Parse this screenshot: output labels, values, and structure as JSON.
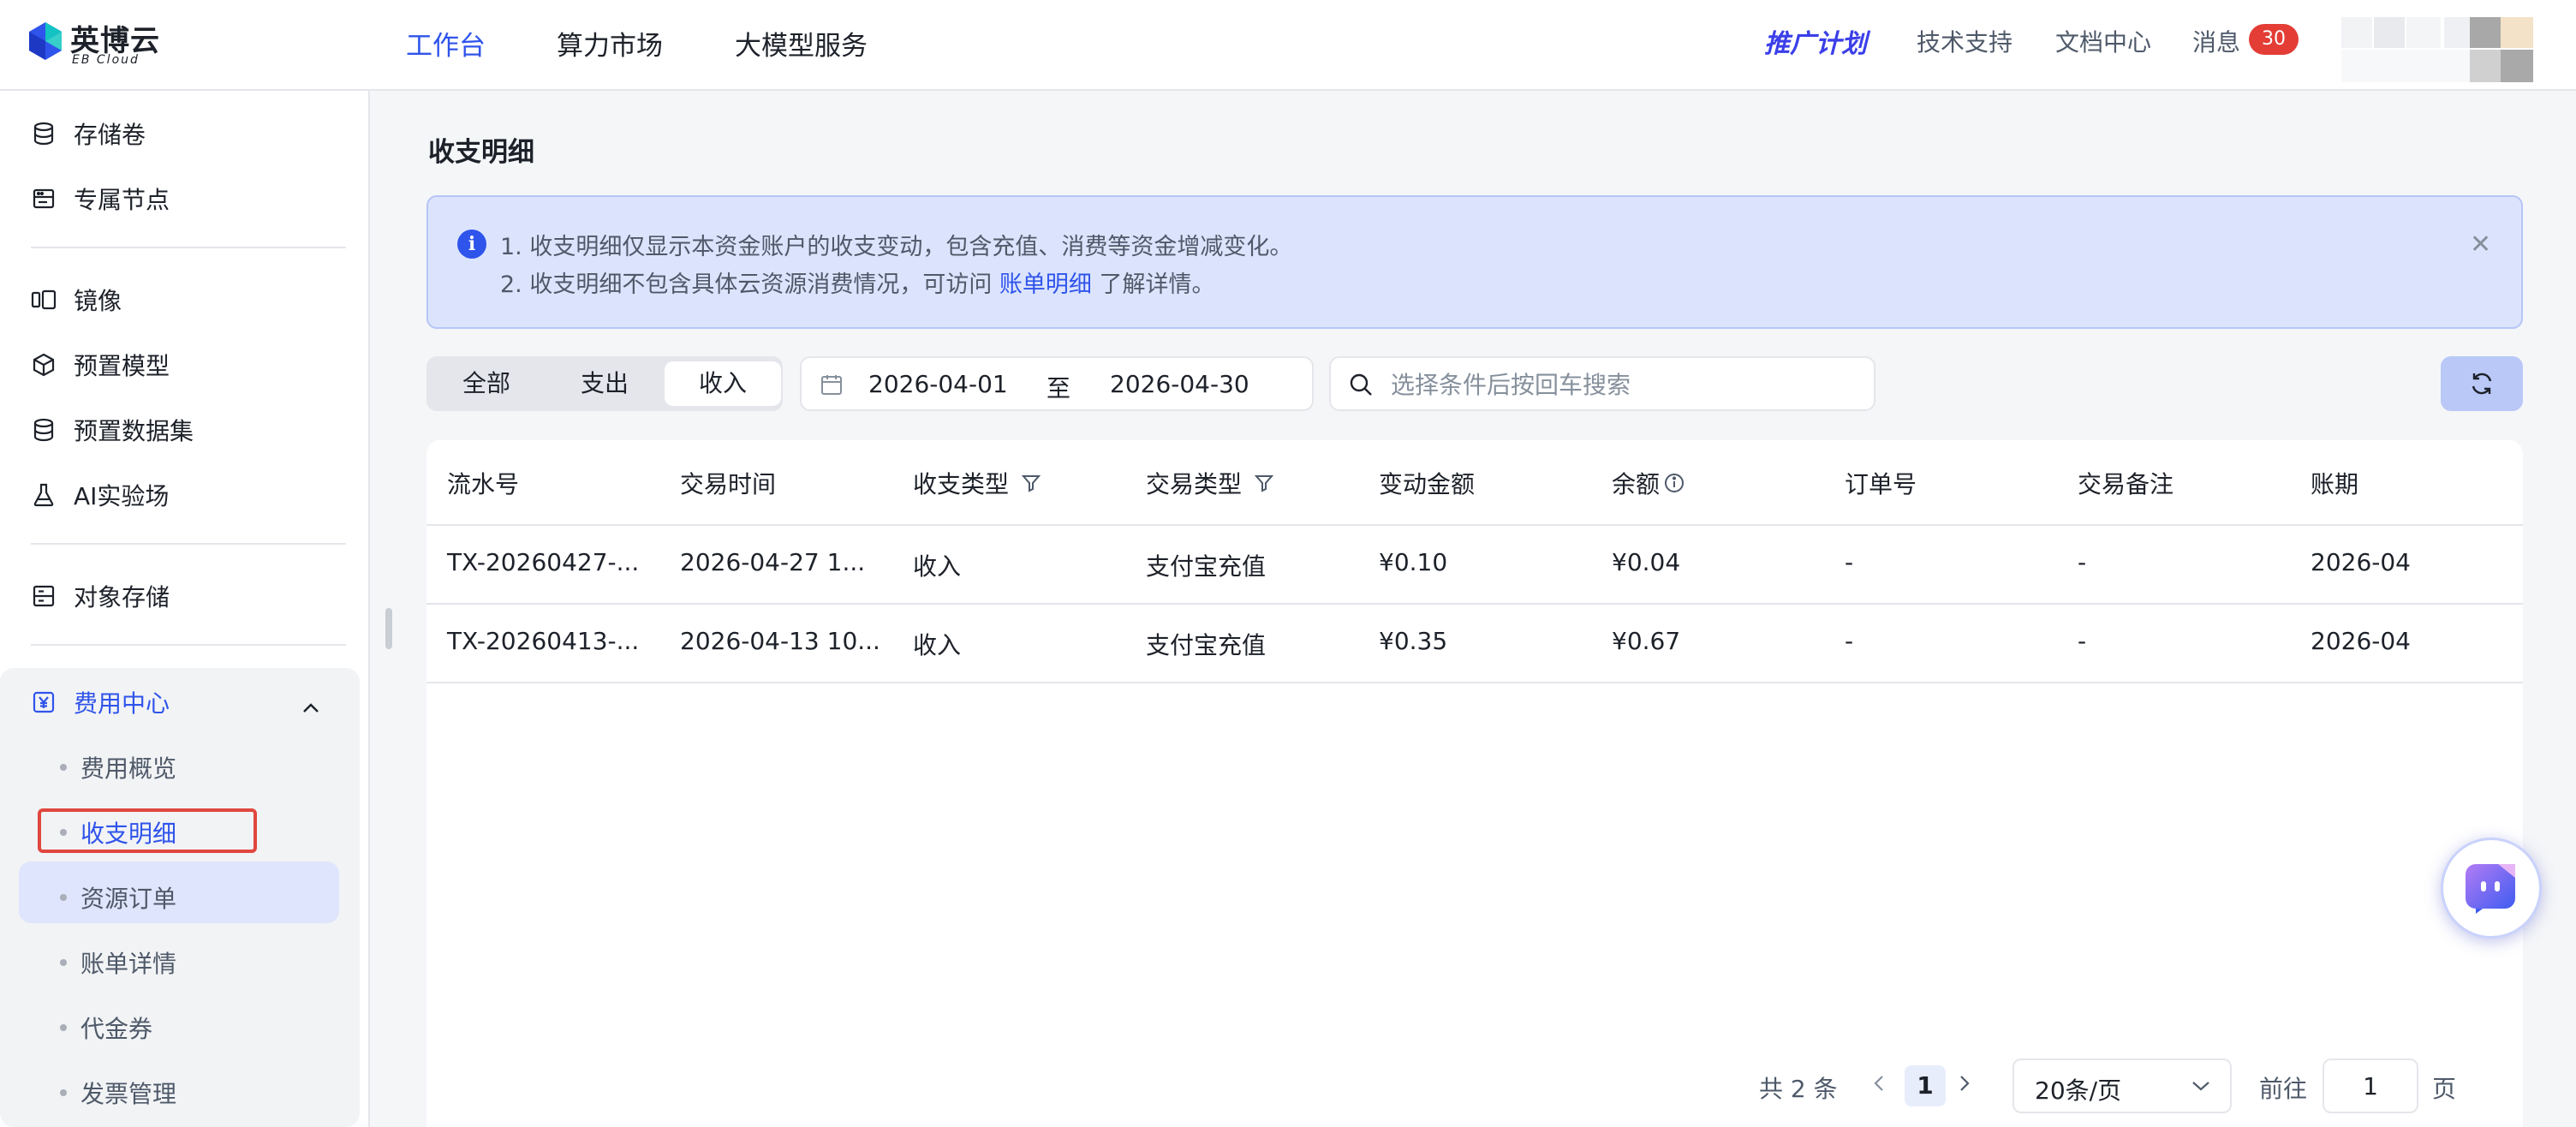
{
  "header": {
    "logo_text": "英博云",
    "logo_sub": "EB Cloud",
    "nav": [
      "工作台",
      "算力市场",
      "大模型服务"
    ],
    "promo": "推广计划",
    "links": [
      "技术支持",
      "文档中心",
      "消息"
    ],
    "msg_count": "30"
  },
  "sidebar": {
    "items": [
      {
        "label": "存储卷",
        "icon": "database-icon"
      },
      {
        "label": "专属节点",
        "icon": "server-icon"
      },
      {
        "label": "镜像",
        "icon": "image-icon"
      },
      {
        "label": "预置模型",
        "icon": "cube-icon"
      },
      {
        "label": "预置数据集",
        "icon": "database-icon"
      },
      {
        "label": "AI实验场",
        "icon": "flask-icon"
      },
      {
        "label": "对象存储",
        "icon": "storage-icon"
      }
    ],
    "group": {
      "label": "费用中心",
      "icon": "yen-icon",
      "subitems": [
        "费用概览",
        "收支明细",
        "资源订单",
        "账单详情",
        "代金券",
        "发票管理"
      ],
      "selected": "收支明细"
    }
  },
  "main": {
    "title": "收支明细",
    "notice": {
      "line1": "1. 收支明细仅显示本资金账户的收支变动，包含充值、消费等资金增减变化。",
      "line2_pre": "2. 收支明细不包含具体云资源消费情况，可访问 ",
      "line2_link": "账单明细",
      "line2_post": " 了解详情。"
    },
    "filter_tabs": [
      "全部",
      "支出",
      "收入"
    ],
    "filter_selected": "收入",
    "date_start": "2026-04-01",
    "date_sep": "至",
    "date_end": "2026-04-30",
    "search_placeholder": "选择条件后按回车搜索"
  },
  "table": {
    "columns": [
      "流水号",
      "交易时间",
      "收支类型",
      "交易类型",
      "变动金额",
      "余额",
      "订单号",
      "交易备注",
      "账期"
    ],
    "rows": [
      [
        "TX-20260427-...",
        "2026-04-27 1...",
        "收入",
        "支付宝充值",
        "¥0.10",
        "¥0.04",
        "-",
        "-",
        "2026-04"
      ],
      [
        "TX-20260413-...",
        "2026-04-13 10...",
        "收入",
        "支付宝充值",
        "¥0.35",
        "¥0.67",
        "-",
        "-",
        "2026-04"
      ]
    ]
  },
  "pagination": {
    "total": "共 2 条",
    "current_page": "1",
    "page_size": "20条/页",
    "goto_label": "前往",
    "goto_value": "1",
    "page_suffix": "页"
  },
  "colors": {
    "accent": "#2f54eb",
    "badge": "#e33d36",
    "notice_bg": "#dce4fd"
  }
}
